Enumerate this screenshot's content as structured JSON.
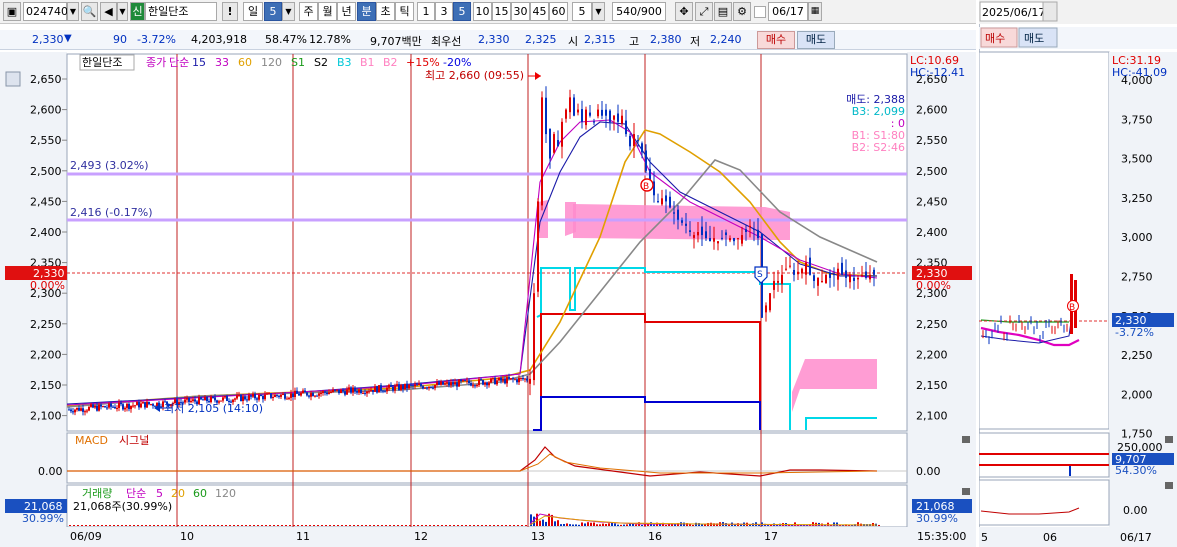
{
  "toolbar": {
    "stock_code": "024740",
    "credit_badge": "신",
    "stock_name": "한일단조",
    "warn": "!",
    "period_day": "일",
    "period_num": "5",
    "week": "주",
    "month": "월",
    "year": "년",
    "minute": "분",
    "second": "초",
    "tick": "틱",
    "minute_options": [
      "1",
      "3",
      "5",
      "10",
      "15",
      "30",
      "45",
      "60"
    ],
    "interval_value": "5",
    "data_count": "540/900",
    "date_value": "06/17"
  },
  "quote": {
    "price": "2,330",
    "change": "90",
    "change_pct": "-3.72%",
    "volume": "4,203,918",
    "vol_ratio": "58.47%",
    "turnover": "12.78%",
    "amount": "9,707백만",
    "best_label": "최우선",
    "best_ask": "2,330",
    "best_bid": "2,325",
    "open_label": "시",
    "open": "2,315",
    "high_label": "고",
    "high": "2,380",
    "low_label": "저",
    "low": "2,240",
    "buy": "매수",
    "sell": "매도"
  },
  "chart": {
    "legend_name": "한일단조",
    "legend_items": [
      {
        "text": "종가",
        "color": "#c000c0"
      },
      {
        "text": "단순",
        "color": "#c000c0"
      },
      {
        "text": "15",
        "color": "#1a1aa8"
      },
      {
        "text": "33",
        "color": "#c000c0"
      },
      {
        "text": "60",
        "color": "#e0a000"
      },
      {
        "text": "120",
        "color": "#888888"
      },
      {
        "text": "S1",
        "color": "#1a9a1a"
      },
      {
        "text": "S2",
        "color": "#000000"
      },
      {
        "text": "B3",
        "color": "#00c8d8"
      },
      {
        "text": "B1",
        "color": "#ff80c0"
      },
      {
        "text": "B2",
        "color": "#ff80c0"
      },
      {
        "text": "+15%",
        "color": "#e00000"
      },
      {
        "text": "-20%",
        "color": "#0000e0"
      }
    ],
    "high_note": "최고 2,660 (09:55)",
    "low_note": "최저 2,105 (14:10)",
    "line1_label": "2,493 (3.02%)",
    "line2_label": "2,416 (-0.17%)",
    "lc_label": "LC:10.69",
    "hc_label": "HC:-12.41",
    "price_tag": "2,330",
    "price_tag_pct": "0.00%",
    "right_legend": [
      "매도: 2,388",
      "B3: 2,099",
      ": 0",
      "B1: S1:80",
      "B2: S2:46"
    ],
    "y_ticks": [
      "2,650",
      "2,600",
      "2,550",
      "2,500",
      "2,450",
      "2,400",
      "2,350",
      "2,300",
      "2,250",
      "2,200",
      "2,150",
      "2,100"
    ],
    "x_labels": [
      "06/09",
      "10",
      "11",
      "12",
      "13",
      "16",
      "17"
    ],
    "time_label": "15:35:00",
    "macd_label": "MACD",
    "signal_label": "시그널",
    "macd_zero": "0.00",
    "vol_title": "거래량",
    "vol_avg": "단순",
    "vol_periods": [
      {
        "text": "5",
        "color": "#c000c0"
      },
      {
        "text": "20",
        "color": "#e0a000"
      },
      {
        "text": "60",
        "color": "#1a9a1a"
      },
      {
        "text": "120",
        "color": "#888888"
      }
    ],
    "vol_value": "21,068주(30.99%)",
    "vol_tag": "21,068",
    "vol_tag_pct": "30.99%",
    "b_marker": "B",
    "s_marker": "S"
  },
  "rpanel": {
    "date": "2025/06/17",
    "buy": "매수",
    "sell": "매도",
    "lc": "LC:31.19",
    "hc": "HC:-41.09",
    "y_ticks": [
      "4,000",
      "3,750",
      "3,500",
      "3,250",
      "3,000",
      "2,750",
      "2,500",
      "2,250",
      "2,000",
      "1,750"
    ],
    "price_tag": "2,330",
    "price_pct": "-3.72%",
    "vol_ticks": [
      "250,000"
    ],
    "vol_tag": "9,707",
    "vol_pct": "54.30%",
    "macd_zero": "0.00",
    "x_labels": [
      "5",
      "06",
      "06/17"
    ],
    "b_marker": "B"
  },
  "colors": {
    "up": "#e00000",
    "down": "#0030c0",
    "accent_blue": "#3d6fb6",
    "price_tag": "#e01010",
    "hline": "#c8a0ff"
  }
}
